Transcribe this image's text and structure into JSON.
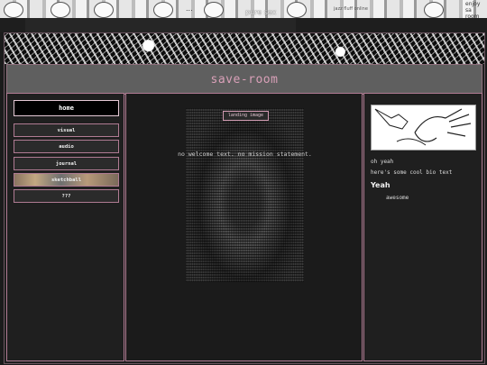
{
  "sticker_strip": {
    "texts": {
      "pure_sex": "pure sex",
      "jazz": "jazz fluff online",
      "enjoy": "enjoy sa room oc",
      "dots": "..."
    }
  },
  "header": {
    "title": "save-room"
  },
  "nav": {
    "items": [
      {
        "label": "home"
      },
      {
        "label": "visual"
      },
      {
        "label": "audio"
      },
      {
        "label": "journal"
      },
      {
        "label": "sketchball"
      },
      {
        "label": "???"
      }
    ]
  },
  "main": {
    "landing_image_alt": "landing image",
    "welcome_text": "no welcome text. no mission statement."
  },
  "sidebar": {
    "greeting": "oh yeah",
    "bio": "here's some cool bio text",
    "heading": "Yeah",
    "item": "awesome"
  },
  "colors": {
    "accent": "#d9a0b8",
    "border": "#b07b93",
    "background": "#1e1e1e"
  },
  "icons": [
    "hand-drawing-image",
    "sticker-banner"
  ]
}
